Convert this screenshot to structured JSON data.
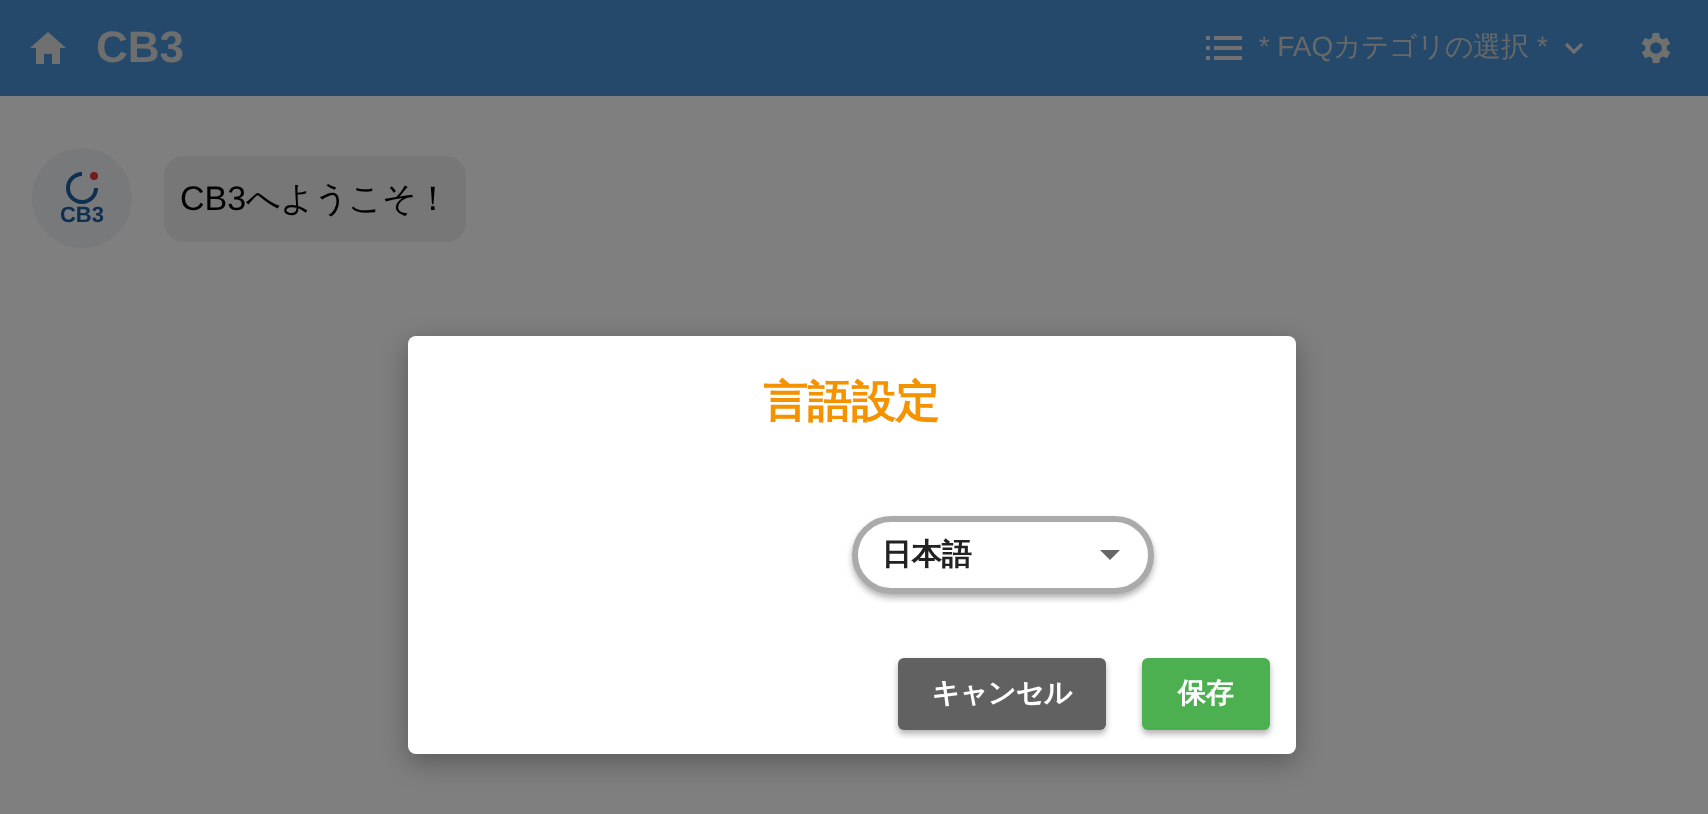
{
  "header": {
    "title": "CB3",
    "category_select": "* FAQカテゴリの選択 *"
  },
  "chat": {
    "messages": [
      {
        "avatar_text": "CB3",
        "text": "CB3へようこそ！"
      }
    ]
  },
  "dialog": {
    "title": "言語設定",
    "language_select": {
      "value": "日本語"
    },
    "buttons": [
      {
        "kind": "secondary",
        "label": "キャンセル"
      },
      {
        "kind": "primary",
        "label": "保存"
      }
    ]
  }
}
